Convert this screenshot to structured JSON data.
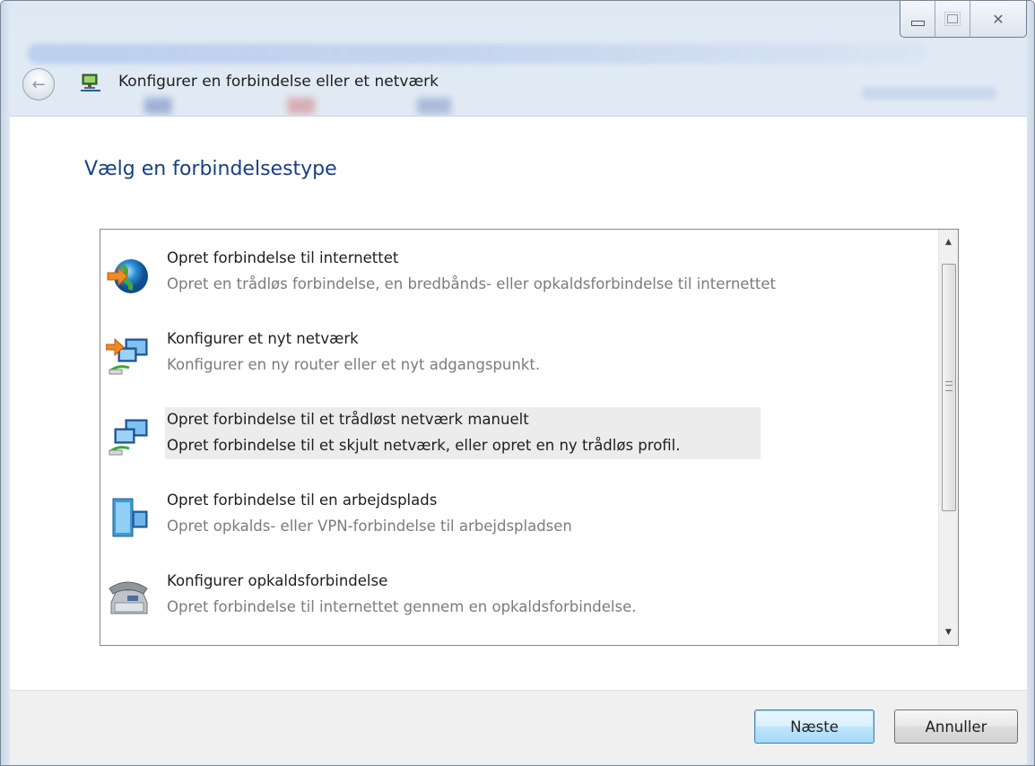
{
  "window": {
    "title": "Konfigurer en forbindelse eller et netværk",
    "caption_buttons": {
      "minimize": "minimize",
      "maximize": "maximize",
      "close": "close"
    }
  },
  "page": {
    "heading": "Vælg en forbindelsestype"
  },
  "options": [
    {
      "title": "Opret forbindelse til internettet",
      "description": "Opret en trådløs forbindelse, en bredbånds- eller opkaldsforbindelse til internettet",
      "icon": "globe-connect-icon",
      "selected": false
    },
    {
      "title": "Konfigurer et nyt netværk",
      "description": "Konfigurer en ny router eller et nyt adgangspunkt.",
      "icon": "network-setup-icon",
      "selected": false
    },
    {
      "title": "Opret forbindelse til et trådløst netværk manuelt",
      "description": "Opret forbindelse til et skjult netværk, eller opret en ny trådløs profil.",
      "icon": "wireless-network-icon",
      "selected": true
    },
    {
      "title": "Opret forbindelse til en arbejdsplads",
      "description": "Opret opkalds- eller VPN-forbindelse til arbejdspladsen",
      "icon": "workplace-building-icon",
      "selected": false
    },
    {
      "title": "Konfigurer opkaldsforbindelse",
      "description": "Opret forbindelse til internettet gennem en opkaldsforbindelse.",
      "icon": "telephone-modem-icon",
      "selected": false
    }
  ],
  "footer": {
    "next_label": "Næste",
    "cancel_label": "Annuller"
  },
  "colors": {
    "heading": "#1a3f80",
    "selected_highlight": "#ececec",
    "secondary_text": "#7b7b7b"
  }
}
